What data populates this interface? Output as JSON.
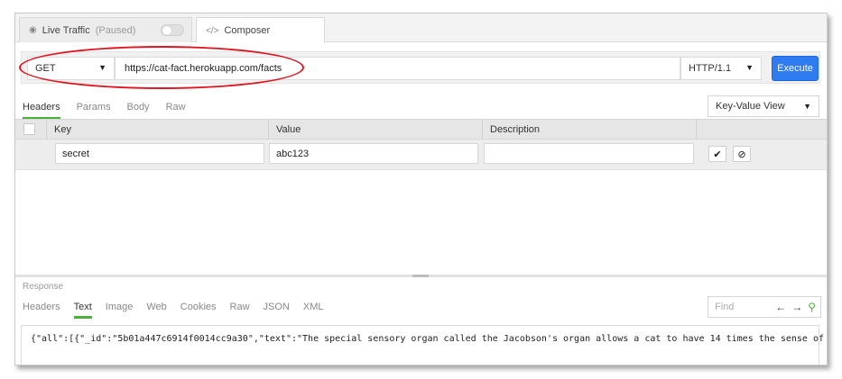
{
  "tabs": {
    "live_traffic": {
      "label": "Live Traffic",
      "status": "(Paused)",
      "icon": "eye-icon"
    },
    "composer": {
      "label": "Composer",
      "icon": "code-icon"
    }
  },
  "request": {
    "method": "GET",
    "url": "https://cat-fact.herokuapp.com/facts",
    "protocol": "HTTP/1.1",
    "execute_label": "Execute"
  },
  "request_tabs": [
    {
      "label": "Headers",
      "active": true
    },
    {
      "label": "Params",
      "active": false
    },
    {
      "label": "Body",
      "active": false
    },
    {
      "label": "Raw",
      "active": false
    }
  ],
  "view_mode": "Key-Value View",
  "headers_table": {
    "columns": [
      "Key",
      "Value",
      "Description"
    ],
    "rows": [
      {
        "key": "secret",
        "value": "abc123",
        "description": ""
      }
    ]
  },
  "response": {
    "label": "Response",
    "tabs": [
      {
        "label": "Headers",
        "active": false
      },
      {
        "label": "Text",
        "active": true
      },
      {
        "label": "Image",
        "active": false
      },
      {
        "label": "Web",
        "active": false
      },
      {
        "label": "Cookies",
        "active": false
      },
      {
        "label": "Raw",
        "active": false
      },
      {
        "label": "JSON",
        "active": false
      },
      {
        "label": "XML",
        "active": false
      }
    ],
    "find_placeholder": "Find",
    "body": "{\"all\":[{\"_id\":\"5b01a447c6914f0014cc9a30\",\"text\":\"The special sensory organ called the Jacobson's organ allows a cat to have 14 times the sense of"
  },
  "colors": {
    "accent": "#4caf3a",
    "execute": "#2f7bf0",
    "highlight": "#e0141e"
  }
}
